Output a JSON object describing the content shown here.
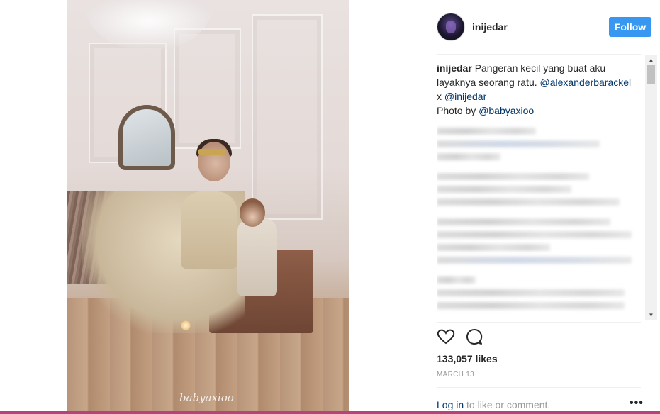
{
  "post": {
    "username": "inijedar",
    "follow_label": "Follow",
    "caption": {
      "username": "inijedar",
      "text_1": "Pangeran kecil yang buat aku layaknya seorang ratu.",
      "mention_1": "@alexanderbarackel",
      "text_2": "x",
      "mention_2": "@inijedar",
      "text_3": "Photo by",
      "mention_3": "@babyaxioo"
    },
    "likes": "133,057 likes",
    "date": "MARCH 13",
    "login": {
      "link": "Log in",
      "rest": "to like or comment."
    },
    "more_label": "•••",
    "photo_watermark": "babyaxioo"
  },
  "icons": {
    "like": "heart-icon",
    "comment": "comment-icon",
    "scroll_up": "scroll-up-arrow-icon",
    "scroll_down": "scroll-down-arrow-icon"
  },
  "colors": {
    "follow_button": "#3897f0",
    "mention": "#003569",
    "muted_text": "#999999",
    "bottom_bar": "#b8437a"
  }
}
